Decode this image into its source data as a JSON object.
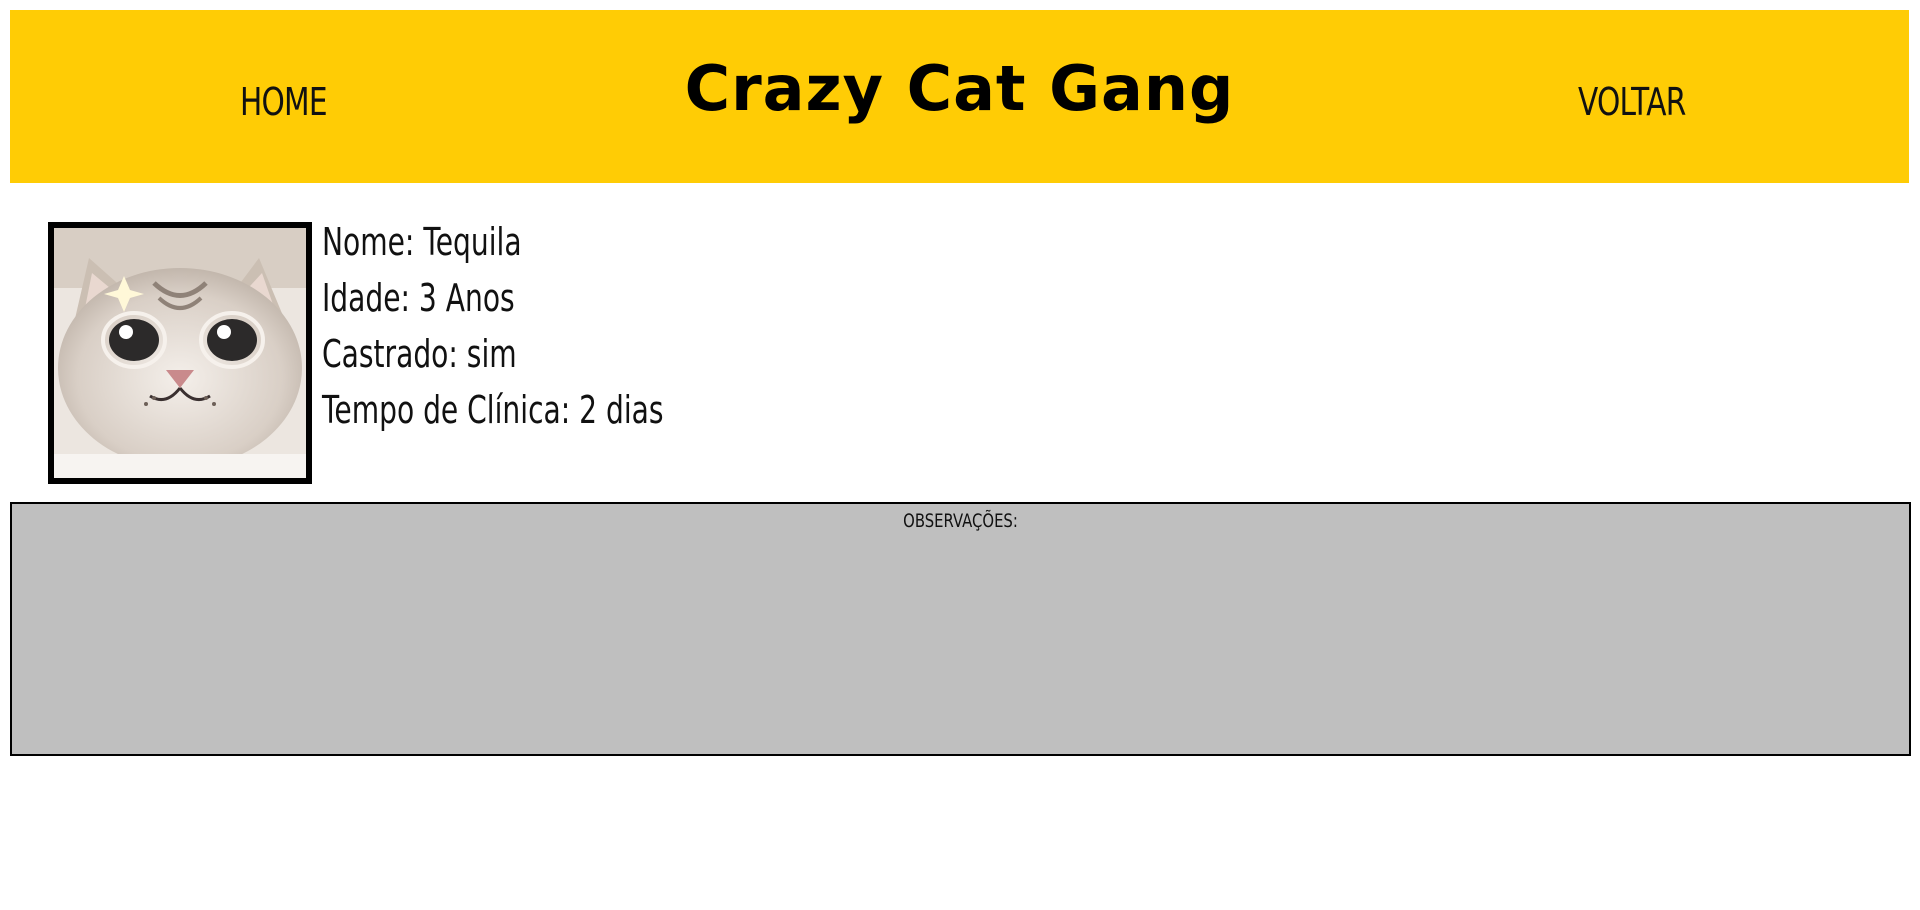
{
  "header": {
    "brand": "Crazy Cat Gang",
    "home_label": "HOME",
    "back_label": "VOLTAR",
    "background_color": "#ffcc05"
  },
  "cat": {
    "photo_icon": "cat-photo",
    "name_line": "Nome: Tequila",
    "age_line": "Idade: 3 Anos",
    "neutered_line": "Castrado: sim",
    "clinic_time_line": "Tempo de Clínica: 2 dias"
  },
  "observations": {
    "label": "OBSERVAÇÕES:",
    "background_color": "#bfbfbf"
  }
}
